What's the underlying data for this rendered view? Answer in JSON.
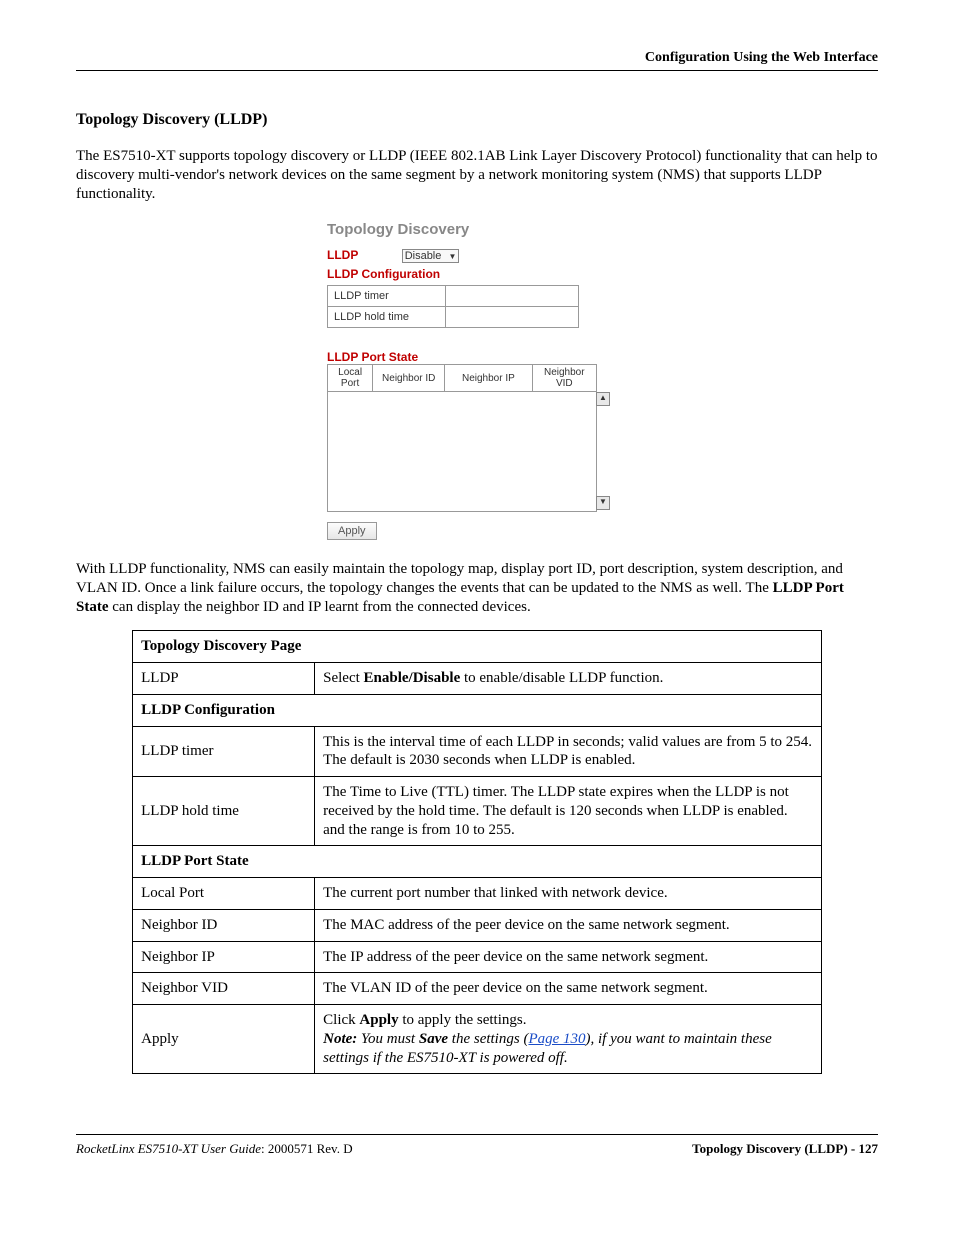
{
  "header": {
    "right": "Configuration Using the Web Interface"
  },
  "section": {
    "heading": "Topology Discovery (LLDP)",
    "intro": "The ES7510-XT supports topology discovery or LLDP (IEEE 802.1AB Link Layer Discovery Protocol) functionality that can help to discovery multi-vendor's network devices on the same segment by a network monitoring system (NMS) that supports LLDP functionality.",
    "after_screenshot_part1": "With LLDP functionality, NMS can easily maintain the topology map, display port ID, port description, system description, and VLAN ID. Once a link failure occurs, the topology changes the events that can be updated to the NMS as well. The ",
    "after_screenshot_bold": "LLDP Port State",
    "after_screenshot_part2": " can display the neighbor ID and IP learnt from the connected devices."
  },
  "screenshot": {
    "title": "Topology Discovery",
    "lldp_label": "LLDP",
    "lldp_select": "Disable",
    "config_heading": "LLDP Configuration",
    "rows": [
      {
        "label": "LLDP timer",
        "value": ""
      },
      {
        "label": "LLDP hold time",
        "value": ""
      }
    ],
    "portstate_heading": "LLDP Port State",
    "cols": [
      "Local Port",
      "Neighbor ID",
      "Neighbor IP",
      "Neighbor VID"
    ],
    "apply": "Apply"
  },
  "table": {
    "caption": "Topology Discovery Page",
    "lldp": {
      "label": "LLDP",
      "desc_prefix": "Select ",
      "desc_bold": "Enable/Disable",
      "desc_suffix": " to enable/disable LLDP function."
    },
    "config_header": "LLDP Configuration",
    "lldp_timer": {
      "label": "LLDP timer",
      "desc": "This is the interval time of each LLDP in seconds; valid values are from 5 to 254. The default is 2030 seconds when LLDP is enabled."
    },
    "lldp_hold": {
      "label": "LLDP hold time",
      "desc": "The Time to Live (TTL) timer. The LLDP state expires when the LLDP is not received by the hold time. The default is 120 seconds when LLDP is enabled. and the range is from 10 to 255."
    },
    "portstate_header": "LLDP Port State",
    "local_port": {
      "label": "Local Port",
      "desc": "The current port number that linked with network device."
    },
    "neighbor_id": {
      "label": "Neighbor ID",
      "desc": "The MAC address of the peer device on the same network segment."
    },
    "neighbor_ip": {
      "label": "Neighbor IP",
      "desc": "The IP address of the peer device on the same network segment."
    },
    "neighbor_vid": {
      "label": "Neighbor VID",
      "desc": "The VLAN ID of the peer device on the same network segment."
    },
    "apply": {
      "label": "Apply",
      "line1_prefix": "Click ",
      "line1_bold": "Apply",
      "line1_suffix": " to apply the settings.",
      "note_label": "Note:",
      "note_text_1": " You must ",
      "note_bold": "Save",
      "note_text_2": " the settings (",
      "note_link": "Page 130",
      "note_text_3": "), if you want to maintain these settings if the ES7510-XT is powered off."
    }
  },
  "footer": {
    "left_italic": "RocketLinx ES7510-XT  User Guide",
    "left_rest": ": 2000571 Rev. D",
    "right": "Topology Discovery (LLDP) - 127"
  }
}
